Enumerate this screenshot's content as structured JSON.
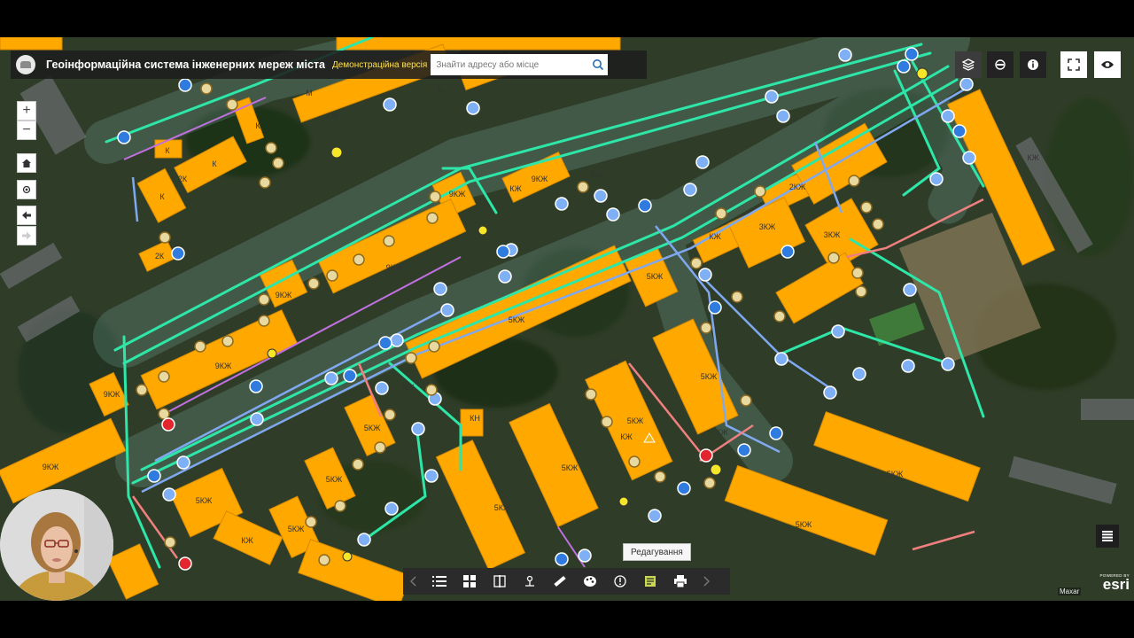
{
  "header": {
    "title": "Геоінформаційна система інженерних мереж міста",
    "subtitle": "Демонстраційна версія",
    "search_placeholder": "Знайти адресу або місце"
  },
  "tooltip": "Редагування",
  "attribution": {
    "powered_by": "POWERED BY",
    "esri": "esri",
    "imagery": "Maxar"
  },
  "map": {
    "building_labels": [
      "К",
      "К",
      "2К",
      "К",
      "К",
      "М",
      "М",
      "М",
      "2К",
      "9КЖ",
      "9КЖ",
      "9КЖ",
      "9КЖ",
      "9КЖ",
      "9КЖ",
      "9КЖ",
      "КЖ",
      "5КЖ",
      "5КЖ",
      "5КЖ",
      "5КЖ",
      "5КЖ",
      "5КЖ",
      "5КЖ",
      "5КЖ",
      "5КЖ",
      "5КЖ",
      "5КЖ",
      "5КЖ",
      "КЖ",
      "КЖ",
      "КН",
      "КЖ",
      "КЖ",
      "2КЖ",
      "3КЖ",
      "3КЖ",
      "КЖ",
      "КЖ",
      "КЖ",
      "КЖ"
    ],
    "colors": {
      "building": "#ffa800",
      "water": "#7fa8f0",
      "heating": "#2de6a8",
      "gas": "#f08080",
      "power": "#c070e0"
    }
  },
  "controls": {
    "zoom_in": "+",
    "zoom_out": "−"
  },
  "icons": {
    "layers": "layers-icon",
    "basemap": "basemap-icon",
    "info": "info-icon",
    "fullscreen": "fullscreen-icon",
    "visibility": "eye-icon",
    "home": "home-icon",
    "locate": "locate-icon",
    "back": "back-arrow-icon",
    "forward": "forward-arrow-icon",
    "search": "search-icon",
    "list": "list-icon",
    "grid": "grid-icon",
    "swipe": "swipe-icon",
    "measure_point": "measure-point-icon",
    "measure": "measure-icon",
    "styles": "palette-icon",
    "about": "about-icon",
    "edit": "edit-icon",
    "print": "print-icon",
    "attribute_table": "table-icon"
  }
}
